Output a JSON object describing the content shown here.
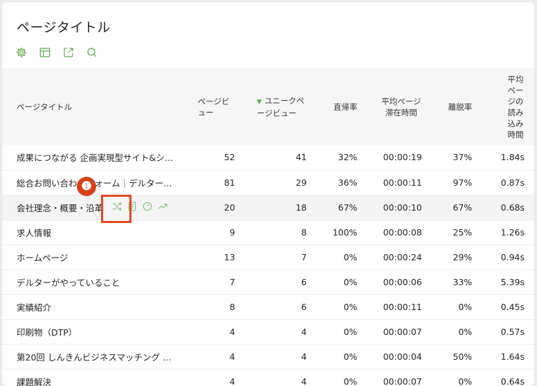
{
  "page": {
    "title": "ページタイトル"
  },
  "table": {
    "headers": {
      "page_title": "ページタイトル",
      "pageviews": "ページビュー",
      "unique_pageviews": "ユニークページビュー",
      "bounce_rate": "直帰率",
      "avg_time": "平均ページ滞在時間",
      "exit_rate": "離脱率",
      "avg_load": "平均ページの読み込み時間"
    },
    "sort_indicator": "▼",
    "rows": [
      [
        "成果につながる 企画実現型サイト&シス…",
        "52",
        "41",
        "32%",
        "00:00:19",
        "37%",
        "1.84s"
      ],
      [
        "総合お問い合わせフォーム｜デルター株…",
        "81",
        "29",
        "36%",
        "00:00:11",
        "97%",
        "0.87s"
      ],
      [
        "会社理念・概要・沿革",
        "20",
        "18",
        "67%",
        "00:00:10",
        "67%",
        "0.68s"
      ],
      [
        "求人情報",
        "9",
        "8",
        "100%",
        "00:00:08",
        "25%",
        "1.26s"
      ],
      [
        "ホームページ",
        "13",
        "7",
        "0%",
        "00:00:24",
        "29%",
        "0.94s"
      ],
      [
        "デルターがやっていること",
        "7",
        "6",
        "0%",
        "00:00:06",
        "33%",
        "5.39s"
      ],
      [
        "実績紹介",
        "8",
        "6",
        "0%",
        "00:00:11",
        "0%",
        "0.45s"
      ],
      [
        "印刷物（DTP）",
        "4",
        "4",
        "0%",
        "00:00:07",
        "0%",
        "0.57s"
      ],
      [
        "第20回 しんきんビジネスマッチング ビ…",
        "4",
        "4",
        "0%",
        "00:00:04",
        "50%",
        "1.64s"
      ],
      [
        "課題解決",
        "4",
        "4",
        "0%",
        "00:00:07",
        "0%",
        "0.64s"
      ]
    ]
  },
  "callout": {
    "number": "❶"
  },
  "colors": {
    "accent": "#5aa84b",
    "callout": "#e0481e"
  }
}
